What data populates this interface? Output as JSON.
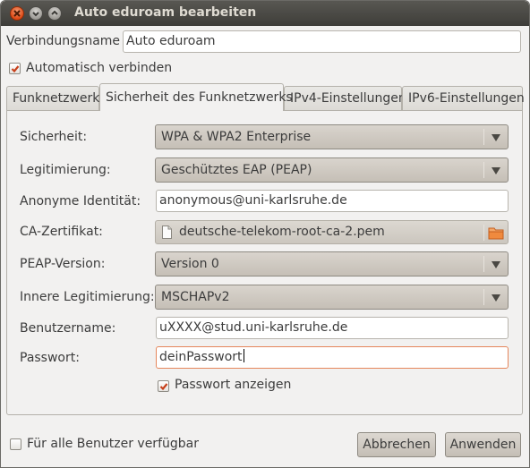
{
  "window": {
    "title": "Auto eduroam bearbeiten"
  },
  "connection": {
    "name_label": "Verbindungsname",
    "name_value": "Auto eduroam",
    "autoconnect_label": "Automatisch verbinden",
    "autoconnect_checked": true
  },
  "tabs": [
    {
      "label": "Funknetzwerk",
      "active": false
    },
    {
      "label": "Sicherheit des Funknetzwerks",
      "active": true
    },
    {
      "label": "IPv4-Einstellungen",
      "active": false
    },
    {
      "label": "IPv6-Einstellungen",
      "active": false
    }
  ],
  "security": {
    "security_label": "Sicherheit:",
    "security_value": "WPA & WPA2 Enterprise",
    "auth_label": "Legitimierung:",
    "auth_value": "Geschütztes EAP (PEAP)",
    "anon_label": "Anonyme Identität:",
    "anon_value": "anonymous@uni-karlsruhe.de",
    "ca_label": "CA-Zertifikat:",
    "ca_value": "deutsche-telekom-root-ca-2.pem",
    "peap_label": "PEAP-Version:",
    "peap_value": "Version 0",
    "inner_label": "Innere Legitimierung:",
    "inner_value": "MSCHAPv2",
    "user_label": "Benutzername:",
    "user_value": "uXXXX@stud.uni-karlsruhe.de",
    "pass_label": "Passwort:",
    "pass_value": "deinPasswort",
    "show_pass_label": "Passwort anzeigen",
    "show_pass_checked": true
  },
  "footer": {
    "all_users_label": "Für alle Benutzer verfügbar",
    "all_users_checked": false,
    "cancel_label": "Abbrechen",
    "apply_label": "Anwenden"
  },
  "colors": {
    "accent": "#dd4814",
    "titlebar": "#3e3d39",
    "window_bg": "#f2f1f0"
  },
  "icons": [
    "close-icon",
    "minimize-icon",
    "maximize-icon",
    "checkmark-icon",
    "document-icon",
    "folder-icon",
    "dropdown-arrow-icon"
  ]
}
